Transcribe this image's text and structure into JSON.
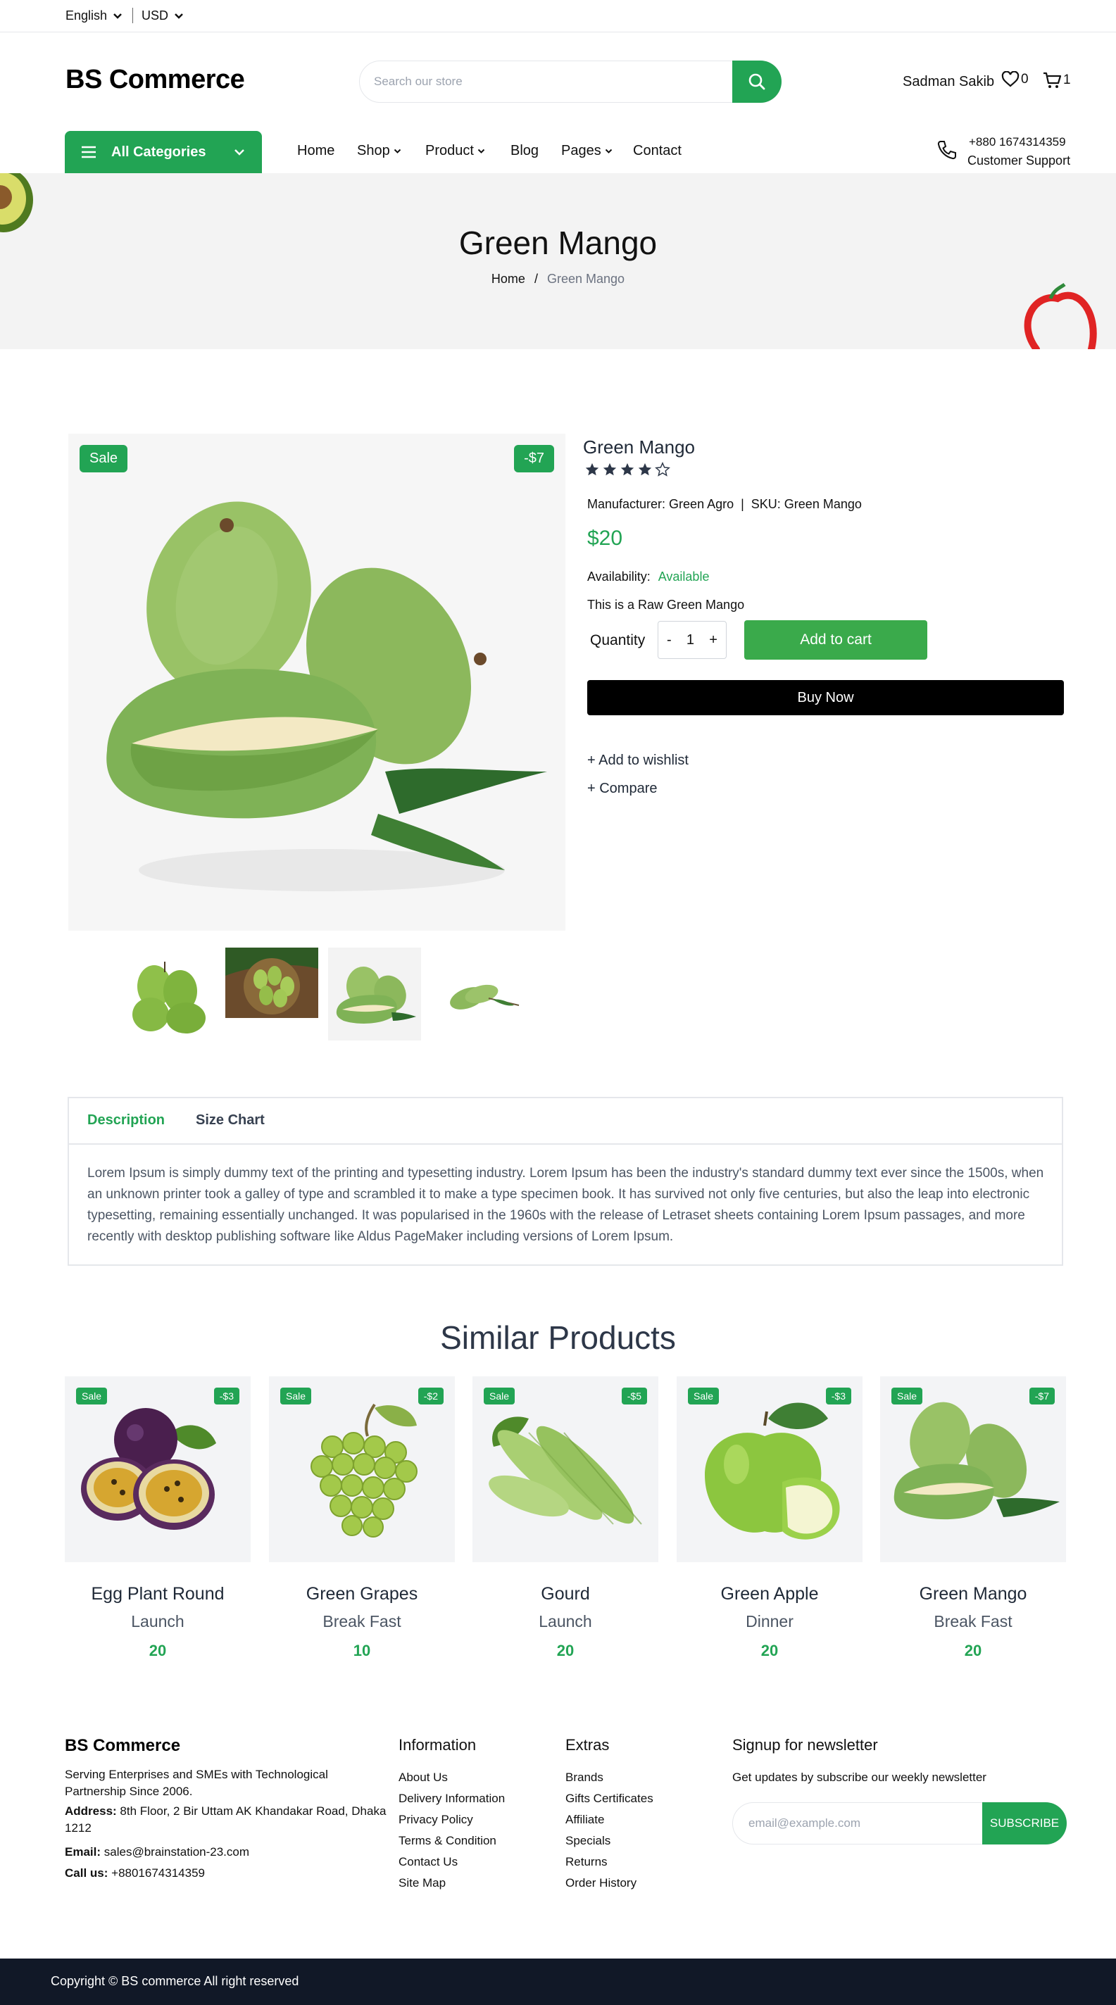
{
  "topbar": {
    "language": "English",
    "currency": "USD"
  },
  "header": {
    "brand": "BS Commerce",
    "search_placeholder": "Search our store",
    "user_name": "Sadman Sakib",
    "wishlist_count": "0",
    "cart_count": "1"
  },
  "nav": {
    "all_categories": "All Categories",
    "items": [
      "Home",
      "Shop",
      "Product",
      "Blog",
      "Pages",
      "Contact"
    ],
    "support_phone": "+880 1674314359",
    "support_label": "Customer Support"
  },
  "banner": {
    "title": "Green Mango",
    "crumb_home": "Home",
    "crumb_sep": "/",
    "crumb_current": "Green Mango"
  },
  "product": {
    "sale_badge": "Sale",
    "discount_badge": "-$7",
    "name": "Green Mango",
    "rating": 4,
    "rating_max": 5,
    "manufacturer_line": "Manufacturer: Green Agro  |  SKU: Green Mango",
    "price": "$20",
    "availability_label": "Availability:",
    "availability_value": "Available",
    "short_description": "This is a Raw Green Mango",
    "quantity_label": "Quantity",
    "qty_minus": "-",
    "qty_value": "1",
    "qty_plus": "+",
    "add_to_cart": "Add to cart",
    "buy_now": "Buy Now",
    "add_to_wishlist": "+ Add to wishlist",
    "compare": "+ Compare"
  },
  "tabs": {
    "description": "Description",
    "size_chart": "Size Chart",
    "body": "Lorem Ipsum is simply dummy text of the printing and typesetting industry. Lorem Ipsum has been the industry's standard dummy text ever since the 1500s, when an unknown printer took a galley of type and scrambled it to make a type specimen book. It has survived not only five centuries, but also the leap into electronic typesetting, remaining essentially unchanged. It was popularised in the 1960s with the release of Letraset sheets containing Lorem Ipsum passages, and more recently with desktop publishing software like Aldus PageMaker including versions of Lorem Ipsum."
  },
  "similar": {
    "title": "Similar Products",
    "items": [
      {
        "name": "Egg Plant Round",
        "category": "Launch",
        "price": "20",
        "sale": "Sale",
        "discount": "-$3"
      },
      {
        "name": "Green Grapes",
        "category": "Break Fast",
        "price": "10",
        "sale": "Sale",
        "discount": "-$2"
      },
      {
        "name": "Gourd",
        "category": "Launch",
        "price": "20",
        "sale": "Sale",
        "discount": "-$5"
      },
      {
        "name": "Green Apple",
        "category": "Dinner",
        "price": "20",
        "sale": "Sale",
        "discount": "-$3"
      },
      {
        "name": "Green Mango",
        "category": "Break Fast",
        "price": "20",
        "sale": "Sale",
        "discount": "-$7"
      }
    ]
  },
  "footer": {
    "brand": "BS Commerce",
    "tagline": "Serving Enterprises and SMEs with Technological Partnership Since 2006.",
    "address_label": "Address:",
    "address": "8th Floor, 2 Bir Uttam AK Khandakar Road, Dhaka 1212",
    "email_label": "Email:",
    "email": "sales@brainstation-23.com",
    "call_label": "Call us:",
    "call": "+8801674314359",
    "info_title": "Information",
    "info_links": [
      "About Us",
      "Delivery Information",
      "Privacy Policy",
      "Terms & Condition",
      "Contact Us",
      "Site Map"
    ],
    "extras_title": "Extras",
    "extras_links": [
      "Brands",
      "Gifts Certificates",
      "Affiliate",
      "Specials",
      "Returns",
      "Order History"
    ],
    "newsletter_title": "Signup for newsletter",
    "newsletter_sub": "Get updates by subscribe our weekly newsletter",
    "newsletter_placeholder": "email@example.com",
    "subscribe": "SUBSCRIBE",
    "copyright": "Copyright © BS commerce All right reserved"
  },
  "colors": {
    "accent": "#22a454",
    "dark": "#111827"
  }
}
